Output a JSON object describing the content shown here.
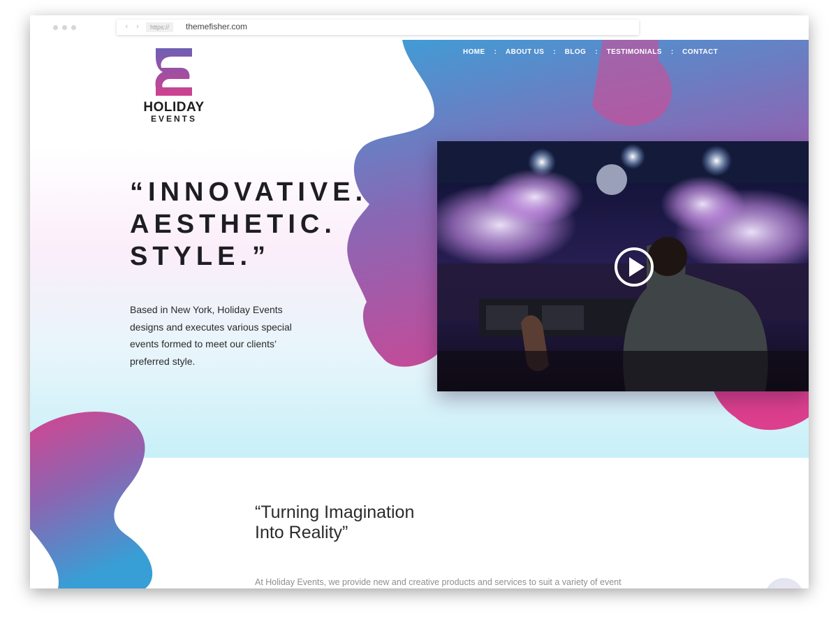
{
  "browser": {
    "protocol": "https://",
    "domain": "themefisher.com",
    "nav_arrows": "‹ ›"
  },
  "logo": {
    "title": "HOLIDAY",
    "subtitle": "EVENTS"
  },
  "nav": {
    "items": [
      {
        "label": "HOME"
      },
      {
        "label": "ABOUT US"
      },
      {
        "label": "BLOG"
      },
      {
        "label": "TESTIMONIALS"
      },
      {
        "label": "CONTACT"
      }
    ],
    "separator": ":"
  },
  "hero": {
    "headline": [
      "“INNOVATIVE.",
      "AESTHETIC.",
      "STYLE.”"
    ],
    "intro": "Based in New York, Holiday Events designs and executes various special events formed to meet our clients’ preferred style."
  },
  "video": {
    "play_icon": "play-icon"
  },
  "about": {
    "title": [
      "“Turning Imagination",
      "Into Reality”"
    ],
    "text": "At Holiday Events, we provide new and creative products and services to suit a variety of event needs. We always strive and commit towards maintaining high standards — together with our"
  },
  "colors": {
    "blob_blue": "#3a9fd6",
    "blob_pink": "#d23f8f",
    "heading": "#1e1e22"
  }
}
